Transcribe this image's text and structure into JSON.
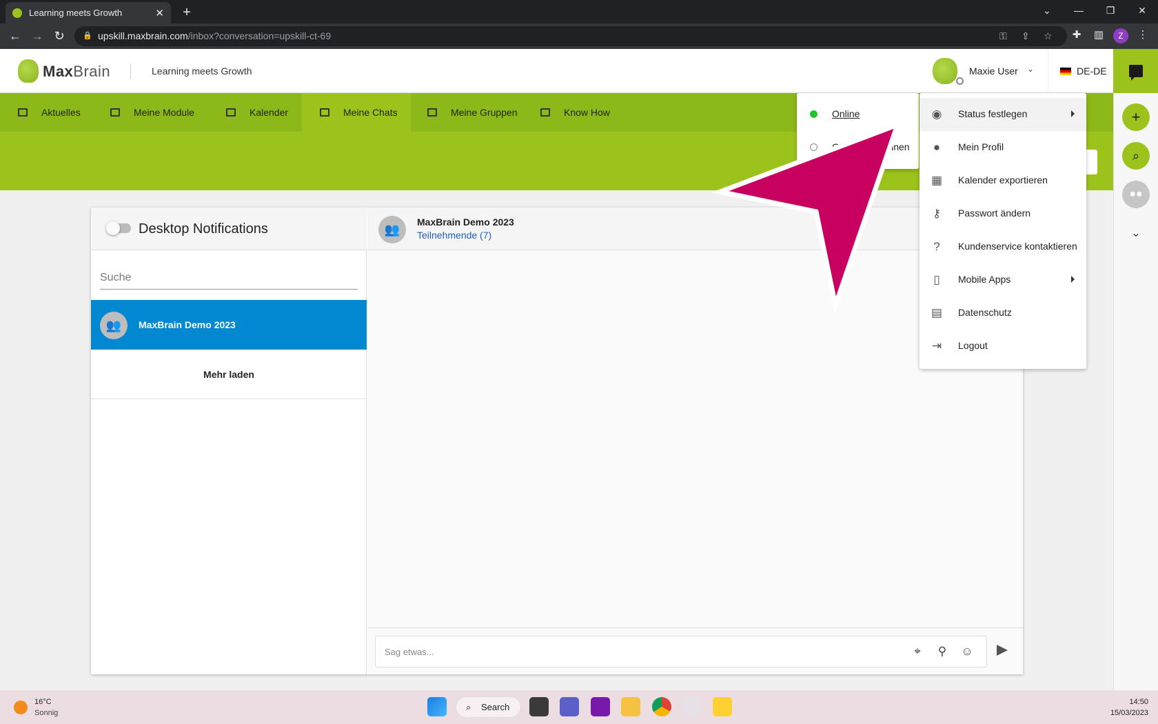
{
  "browser": {
    "tab_title": "Learning meets Growth",
    "url_host": "upskill.maxbrain.com",
    "url_path": "/inbox?conversation=upskill-ct-69",
    "profile_initial": "Z"
  },
  "header": {
    "logo_max": "Max",
    "logo_brain": "Brain",
    "tagline": "Learning meets Growth",
    "user_name": "Maxie User",
    "language": "DE-DE"
  },
  "nav": {
    "items": [
      {
        "label": "Aktuelles"
      },
      {
        "label": "Meine Module"
      },
      {
        "label": "Kalender"
      },
      {
        "label": "Meine Chats"
      },
      {
        "label": "Meine Gruppen"
      },
      {
        "label": "Know How"
      }
    ],
    "active": "Meine Chats"
  },
  "chat": {
    "notifications_title": "Desktop Notifications",
    "search_placeholder": "Suche",
    "conversation_name": "MaxBrain Demo 2023",
    "load_more": "Mehr laden",
    "header_title": "MaxBrain Demo 2023",
    "participants": "Teilnehmende (7)",
    "compose_placeholder": "Sag etwas..."
  },
  "status_menu": {
    "online": "Online",
    "offline": "Offline erscheinen"
  },
  "user_menu": {
    "items": [
      {
        "label": "Status festlegen",
        "icon": "eye-icon"
      },
      {
        "label": "Mein Profil",
        "icon": "account-icon"
      },
      {
        "label": "Kalender exportieren",
        "icon": "calendar-icon"
      },
      {
        "label": "Passwort ändern",
        "icon": "key-icon"
      },
      {
        "label": "Kundenservice kontaktieren",
        "icon": "help-chat-icon"
      },
      {
        "label": "Mobile Apps",
        "icon": "phone-icon"
      },
      {
        "label": "Datenschutz",
        "icon": "privacy-file-icon"
      },
      {
        "label": "Logout",
        "icon": "logout-icon"
      }
    ]
  },
  "colors": {
    "brand_green": "#9bc31c",
    "nav_green": "#8cb819",
    "selected_blue": "#0288d1",
    "online_green": "#22c32e",
    "callout_magenta": "#c8005f"
  },
  "taskbar": {
    "temperature": "16°C",
    "weather": "Sonnig",
    "search_label": "Search",
    "time": "14:50",
    "date": "15/03/2023"
  }
}
